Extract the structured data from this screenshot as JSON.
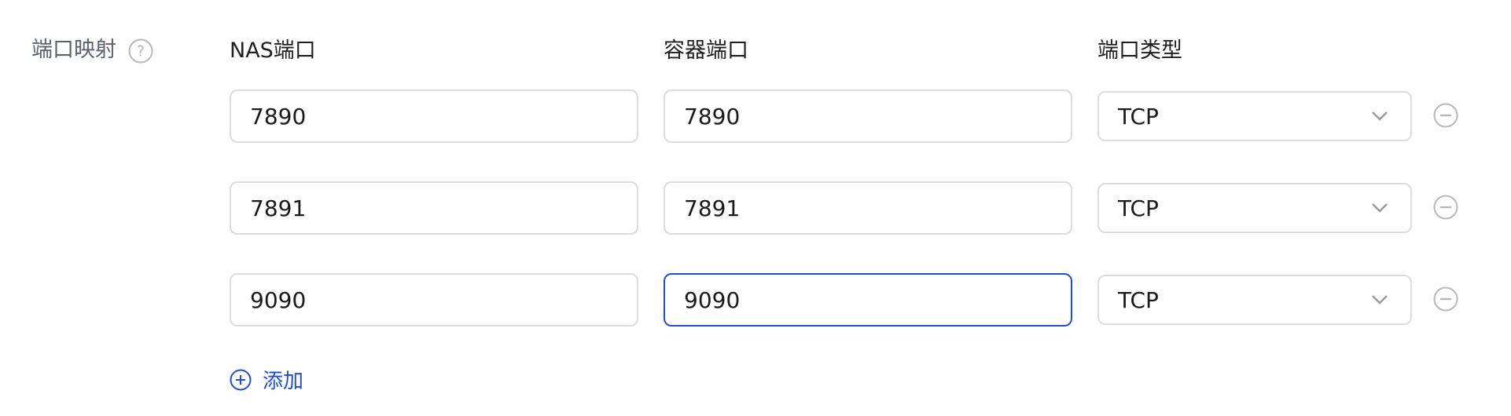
{
  "section": {
    "label": "端口映射",
    "help_icon": "question-circle-icon"
  },
  "headers": {
    "nas_port": "NAS端口",
    "container_port": "容器端口",
    "port_type": "端口类型"
  },
  "rows": [
    {
      "nas_port": "7890",
      "container_port": "7890",
      "type": "TCP",
      "remove_icon": "minus-circle-icon"
    },
    {
      "nas_port": "7891",
      "container_port": "7891",
      "type": "TCP",
      "remove_icon": "minus-circle-icon"
    },
    {
      "nas_port": "9090",
      "container_port": "9090",
      "type": "TCP",
      "remove_icon": "minus-circle-icon",
      "container_focused": true
    }
  ],
  "add": {
    "label": "添加",
    "icon": "plus-circle-icon"
  },
  "colors": {
    "accent": "#1d4ed8",
    "border": "#dcdcdc",
    "label": "#5a6270",
    "icon_gray": "#b8b8b8"
  }
}
